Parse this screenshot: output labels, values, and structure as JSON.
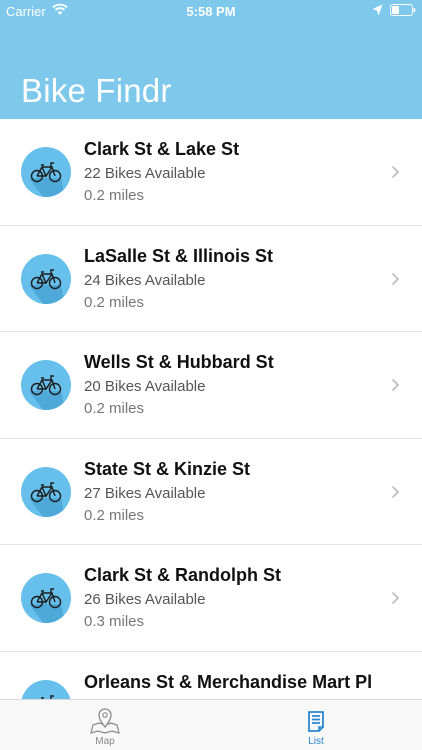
{
  "status_bar": {
    "carrier": "Carrier",
    "time": "5:58 PM"
  },
  "header": {
    "title": "Bike Findr"
  },
  "stations": [
    {
      "name": "Clark St & Lake St",
      "bikes": "22 Bikes Available",
      "distance": "0.2 miles"
    },
    {
      "name": "LaSalle St & Illinois St",
      "bikes": "24 Bikes Available",
      "distance": "0.2 miles"
    },
    {
      "name": "Wells St & Hubbard St",
      "bikes": "20 Bikes Available",
      "distance": "0.2 miles"
    },
    {
      "name": "State St & Kinzie St",
      "bikes": "27 Bikes Available",
      "distance": "0.2 miles"
    },
    {
      "name": "Clark St & Randolph St",
      "bikes": "26 Bikes Available",
      "distance": "0.3 miles"
    },
    {
      "name": "Orleans St & Merchandise Mart Pl",
      "bikes": "",
      "distance": ""
    }
  ],
  "tabbar": {
    "tabs": [
      {
        "label": "Map",
        "icon": "map-pin-icon",
        "selected": false
      },
      {
        "label": "List",
        "icon": "list-icon",
        "selected": true
      }
    ]
  },
  "colors": {
    "header": "#7ec8ec",
    "avatar": "#67c0ec",
    "tab_active": "#2a87d0",
    "tab_inactive": "#8a8a8a"
  }
}
